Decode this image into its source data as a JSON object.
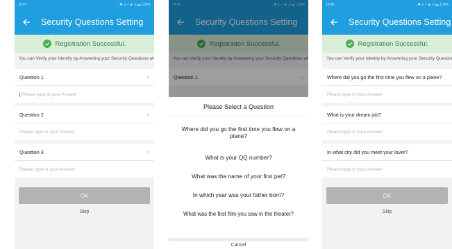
{
  "status_bar": {
    "p1_time": "16:41",
    "p2_time": "16:42",
    "p3_time": "16:43",
    "right_icons": "... ✱ ⊙ ▿ ◈ .ıl ▬ 100%"
  },
  "screen1": {
    "title": "Security Questions Setting",
    "banner": "Registration Successful.",
    "info": "You can Verify your Identity by Answering your Security Questions when using a New Device",
    "questions": [
      {
        "label": "Question 1",
        "answer_placeholder": "Please type in your Answer"
      },
      {
        "label": "Question 2",
        "answer_placeholder": "Please type in your Answer"
      },
      {
        "label": "Question 3",
        "answer_placeholder": "Please type in your Answer"
      }
    ],
    "ok": "OK",
    "skip": "Skip"
  },
  "screen2": {
    "title": "Security Questions Setting",
    "banner": "Registration Successful.",
    "info": "You can Verify your Identity by Answering your Security Questions when using a New Device",
    "question1": "Question 1",
    "sheet_title": "Please Select a Question",
    "options": [
      "Where did you go the first time you flew on a plane?",
      "What is your QQ number?",
      "What was the name of your first pet?",
      "In which year was your father born?",
      "What was the first film you saw in the theater?"
    ],
    "cancel": "Cancel"
  },
  "screen3": {
    "title": "Security Questions Setting",
    "banner": "Registration Successful.",
    "info": "You can Verify your Identity by Answering your Security Questions when using a New Device",
    "questions": [
      {
        "label": "Where did you go the first time you flew on a plane?",
        "answer_placeholder": "Please type in your Answer"
      },
      {
        "label": "What is your dream job?",
        "answer_placeholder": "Please type in your Answer"
      },
      {
        "label": "In what city did you meet your lover?",
        "answer_placeholder": "Please type in your Answer"
      }
    ],
    "ok": "OK",
    "skip": "Skip"
  },
  "colors": {
    "appbar": "#1f9ee0",
    "banner_bg": "#d9eed9",
    "success": "#4caf50",
    "button_disabled": "#b3b3b3"
  }
}
